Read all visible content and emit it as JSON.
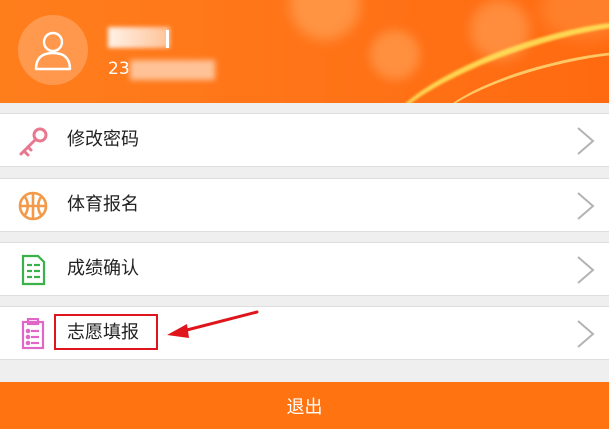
{
  "header": {
    "name_masked": "",
    "student_id_prefix": "23"
  },
  "menu": [
    {
      "label": "修改密码",
      "icon": "key-icon",
      "color": "#e8788f"
    },
    {
      "label": "体育报名",
      "icon": "basketball-icon",
      "color": "#f39a4a"
    },
    {
      "label": "成绩确认",
      "icon": "score-sheet-icon",
      "color": "#3bb14a"
    },
    {
      "label": "志愿填报",
      "icon": "clipboard-list-icon",
      "color": "#e066c8"
    }
  ],
  "logout_label": "退出",
  "colors": {
    "brand_orange": "#ff7310",
    "highlight_red": "#e0141b",
    "background": "#efefef"
  }
}
